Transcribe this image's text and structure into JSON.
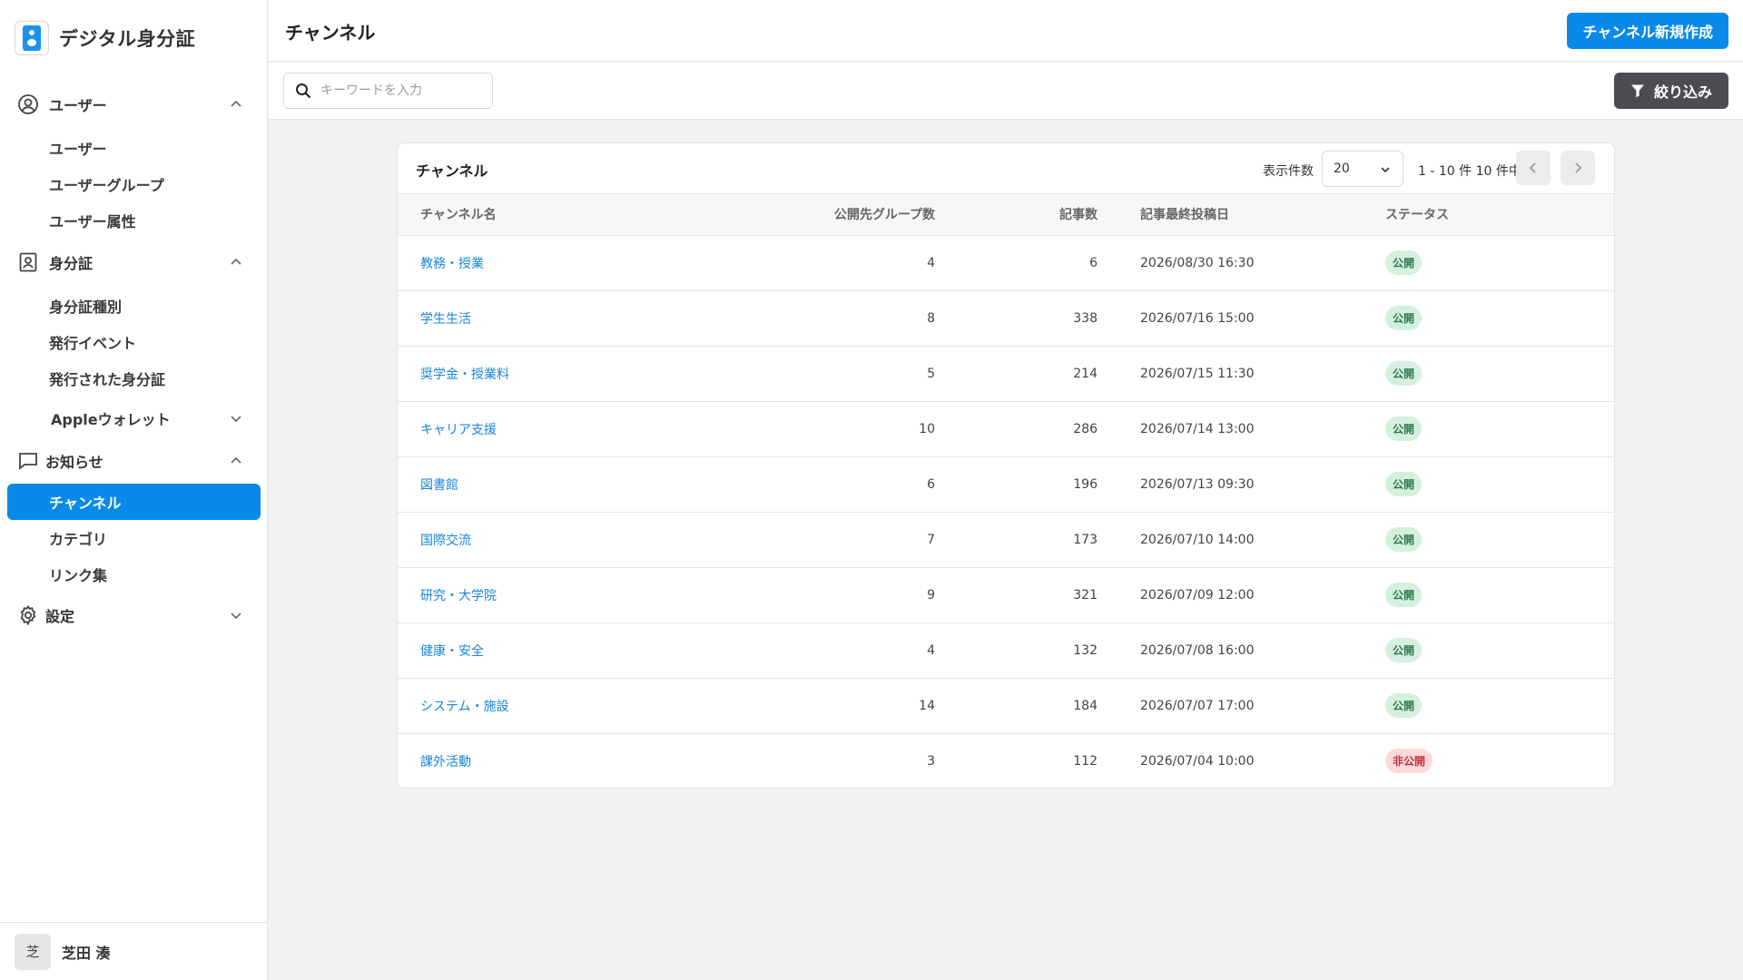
{
  "app": {
    "name": "デジタル身分証"
  },
  "sidebar": {
    "groups": [
      {
        "label": "ユーザー",
        "items": [
          "ユーザー",
          "ユーザーグループ",
          "ユーザー属性"
        ]
      },
      {
        "label": "身分証",
        "items": [
          "身分証種別",
          "発行イベント",
          "発行された身分証"
        ],
        "sub_collapsed": "Appleウォレット"
      },
      {
        "label": "お知らせ",
        "items": [
          "チャンネル",
          "カテゴリ",
          "リンク集"
        ]
      },
      {
        "label": "設定",
        "items": []
      }
    ]
  },
  "user": {
    "avatar_text": "芝",
    "name": "芝田 湊"
  },
  "header": {
    "title": "チャンネル",
    "create_button": "チャンネル新規作成"
  },
  "toolbar": {
    "search_placeholder": "キーワードを入力",
    "filter_button": "絞り込み"
  },
  "card": {
    "title": "チャンネル",
    "per_page_label": "表示件数",
    "per_page_value": "20",
    "range_text": "1 - 10 件 10 件中"
  },
  "table": {
    "columns": [
      "チャンネル名",
      "公開先グループ数",
      "記事数",
      "記事最終投稿日",
      "ステータス"
    ],
    "rows": [
      {
        "name": "教務・授業",
        "groups": "4",
        "posts": "6",
        "date": "2026/08/30 16:30",
        "status": "公開"
      },
      {
        "name": "学生生活",
        "groups": "8",
        "posts": "338",
        "date": "2026/07/16 15:00",
        "status": "公開"
      },
      {
        "name": "奨学金・授業料",
        "groups": "5",
        "posts": "214",
        "date": "2026/07/15 11:30",
        "status": "公開"
      },
      {
        "name": "キャリア支援",
        "groups": "10",
        "posts": "286",
        "date": "2026/07/14 13:00",
        "status": "公開"
      },
      {
        "name": "図書館",
        "groups": "6",
        "posts": "196",
        "date": "2026/07/13 09:30",
        "status": "公開"
      },
      {
        "name": "国際交流",
        "groups": "7",
        "posts": "173",
        "date": "2026/07/10 14:00",
        "status": "公開"
      },
      {
        "name": "研究・大学院",
        "groups": "9",
        "posts": "321",
        "date": "2026/07/09 12:00",
        "status": "公開"
      },
      {
        "name": "健康・安全",
        "groups": "4",
        "posts": "132",
        "date": "2026/07/08 16:00",
        "status": "公開"
      },
      {
        "name": "システム・施設",
        "groups": "14",
        "posts": "184",
        "date": "2026/07/07 17:00",
        "status": "公開"
      },
      {
        "name": "課外活動",
        "groups": "3",
        "posts": "112",
        "date": "2026/07/04 10:00",
        "status": "非公開"
      }
    ]
  },
  "colors": {
    "accent": "#0a8ae8",
    "link": "#1a86d6",
    "status_public_bg": "#d6f0e0",
    "status_private_bg": "#fbd9dc"
  }
}
